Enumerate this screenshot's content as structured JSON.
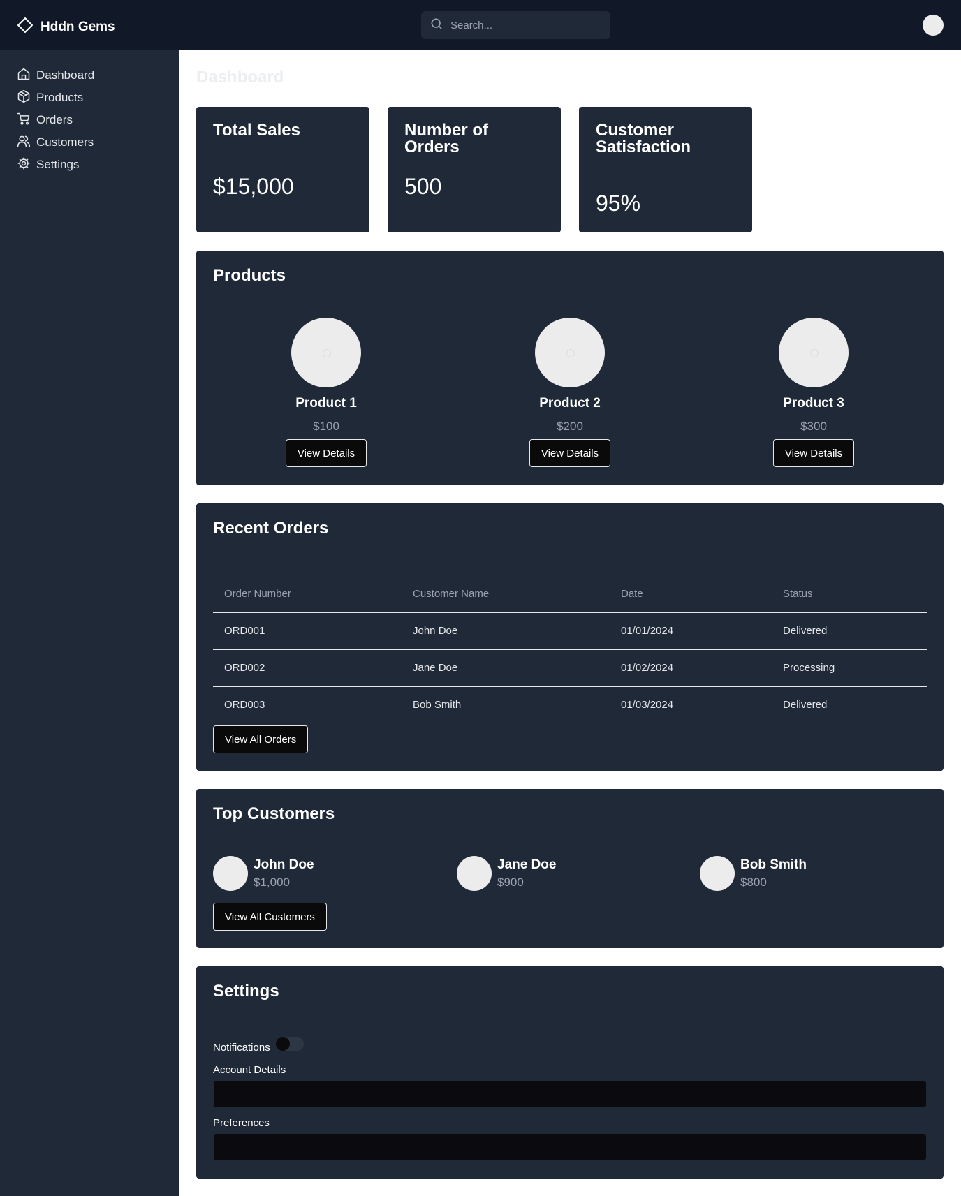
{
  "header": {
    "brand": "Hddn Gems",
    "search_placeholder": "Search..."
  },
  "sidebar": {
    "items": [
      {
        "label": "Dashboard",
        "icon": "home-icon"
      },
      {
        "label": "Products",
        "icon": "package-icon"
      },
      {
        "label": "Orders",
        "icon": "cart-icon"
      },
      {
        "label": "Customers",
        "icon": "users-icon"
      },
      {
        "label": "Settings",
        "icon": "gear-icon"
      }
    ]
  },
  "main": {
    "title": "Dashboard",
    "stats": [
      {
        "title": "Total Sales",
        "value": "$15,000"
      },
      {
        "title": "Number of Orders",
        "value": "500"
      },
      {
        "title": "Customer Satisfaction",
        "value": "95%"
      }
    ],
    "products": {
      "title": "Products",
      "items": [
        {
          "name": "Product 1",
          "price": "$100",
          "button": "View Details"
        },
        {
          "name": "Product 2",
          "price": "$200",
          "button": "View Details"
        },
        {
          "name": "Product 3",
          "price": "$300",
          "button": "View Details"
        }
      ]
    },
    "orders": {
      "title": "Recent Orders",
      "columns": [
        "Order Number",
        "Customer Name",
        "Date",
        "Status"
      ],
      "rows": [
        [
          "ORD001",
          "John Doe",
          "01/01/2024",
          "Delivered"
        ],
        [
          "ORD002",
          "Jane Doe",
          "01/02/2024",
          "Processing"
        ],
        [
          "ORD003",
          "Bob Smith",
          "01/03/2024",
          "Delivered"
        ]
      ],
      "button": "View All Orders"
    },
    "customers": {
      "title": "Top Customers",
      "items": [
        {
          "name": "John Doe",
          "amount": "$1,000"
        },
        {
          "name": "Jane Doe",
          "amount": "$900"
        },
        {
          "name": "Bob Smith",
          "amount": "$800"
        }
      ],
      "button": "View All Customers"
    },
    "settings": {
      "title": "Settings",
      "notifications_label": "Notifications",
      "notifications_on": false,
      "account_label": "Account Details",
      "account_value": "",
      "preferences_label": "Preferences",
      "preferences_value": ""
    }
  },
  "colors": {
    "header_bg": "#111827",
    "sidebar_bg": "#1f2937",
    "card_bg": "#1f2937",
    "muted_text": "#9ca3af",
    "button_bg": "#0a0a0a"
  }
}
